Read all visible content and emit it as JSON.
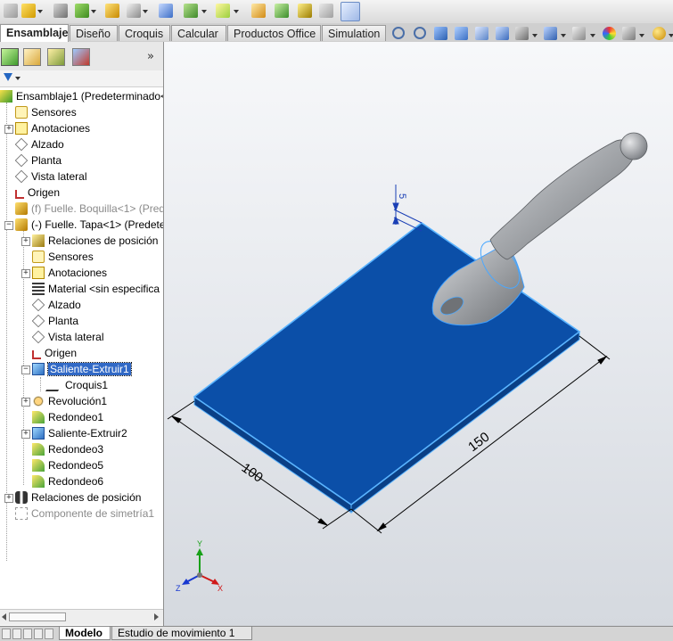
{
  "command_tabs": [
    {
      "label": "Ensamblaje",
      "active": true
    },
    {
      "label": "Diseño",
      "active": false
    },
    {
      "label": "Croquis",
      "active": false
    },
    {
      "label": "Calcular",
      "active": false
    },
    {
      "label": "Productos Office",
      "active": false
    },
    {
      "label": "Simulation",
      "active": false
    }
  ],
  "tree": {
    "items": [
      {
        "label": "Ensamblaje1  (Predeterminado<",
        "icon": "assembly-icon",
        "muted": false,
        "selected": false
      },
      {
        "label": "Sensores",
        "icon": "sensor-icon",
        "muted": false,
        "selected": false
      },
      {
        "label": "Anotaciones",
        "icon": "annotation-icon",
        "muted": false,
        "selected": false
      },
      {
        "label": "Alzado",
        "icon": "plane-icon",
        "muted": false,
        "selected": false
      },
      {
        "label": "Planta",
        "icon": "plane-icon",
        "muted": false,
        "selected": false
      },
      {
        "label": "Vista lateral",
        "icon": "plane-icon",
        "muted": false,
        "selected": false
      },
      {
        "label": "Origen",
        "icon": "origin-icon",
        "muted": false,
        "selected": false
      },
      {
        "label": "(f) Fuelle. Boquilla<1> (Pred",
        "icon": "part-icon",
        "muted": true,
        "selected": false
      },
      {
        "label": "(-) Fuelle. Tapa<1> (Predete",
        "icon": "part-icon",
        "muted": false,
        "selected": false
      },
      {
        "label": "Relaciones de posición",
        "icon": "mate-relations-icon",
        "muted": false,
        "selected": false
      },
      {
        "label": "Sensores",
        "icon": "sensor-icon",
        "muted": false,
        "selected": false
      },
      {
        "label": "Anotaciones",
        "icon": "annotation-icon",
        "muted": false,
        "selected": false
      },
      {
        "label": "Material <sin especifica",
        "icon": "material-icon",
        "muted": false,
        "selected": false
      },
      {
        "label": "Alzado",
        "icon": "plane-icon",
        "muted": false,
        "selected": false
      },
      {
        "label": "Planta",
        "icon": "plane-icon",
        "muted": false,
        "selected": false
      },
      {
        "label": "Vista lateral",
        "icon": "plane-icon",
        "muted": false,
        "selected": false
      },
      {
        "label": "Origen",
        "icon": "origin-icon",
        "muted": false,
        "selected": false
      },
      {
        "label": "Saliente-Extruir1",
        "icon": "extrude-icon",
        "muted": false,
        "selected": true
      },
      {
        "label": "Croquis1",
        "icon": "sketch-icon",
        "muted": false,
        "selected": false
      },
      {
        "label": "Revolución1",
        "icon": "revolve-icon",
        "muted": false,
        "selected": false
      },
      {
        "label": "Redondeo1",
        "icon": "fillet-icon",
        "muted": false,
        "selected": false
      },
      {
        "label": "Saliente-Extruir2",
        "icon": "extrude-icon",
        "muted": false,
        "selected": false
      },
      {
        "label": "Redondeo3",
        "icon": "fillet-icon",
        "muted": false,
        "selected": false
      },
      {
        "label": "Redondeo5",
        "icon": "fillet-icon",
        "muted": false,
        "selected": false
      },
      {
        "label": "Redondeo6",
        "icon": "fillet-icon",
        "muted": false,
        "selected": false
      },
      {
        "label": "Relaciones de posición",
        "icon": "mates-icon",
        "muted": false,
        "selected": false
      },
      {
        "label": "Componente de simetría1",
        "icon": "mirror-component-icon",
        "muted": true,
        "selected": false
      }
    ]
  },
  "viewport": {
    "dimension_width": "100",
    "dimension_length": "150",
    "dimension_thickness": "5",
    "triad_x": "X",
    "triad_y": "Y",
    "triad_z": "Z",
    "plate_color": "#0b4fa8",
    "plate_edge_color": "#5ab4ff",
    "handle_color": "#a9acb0"
  },
  "bottom_tabs": [
    {
      "label": "Modelo",
      "active": true
    },
    {
      "label": "Estudio de movimiento 1",
      "active": false
    }
  ]
}
